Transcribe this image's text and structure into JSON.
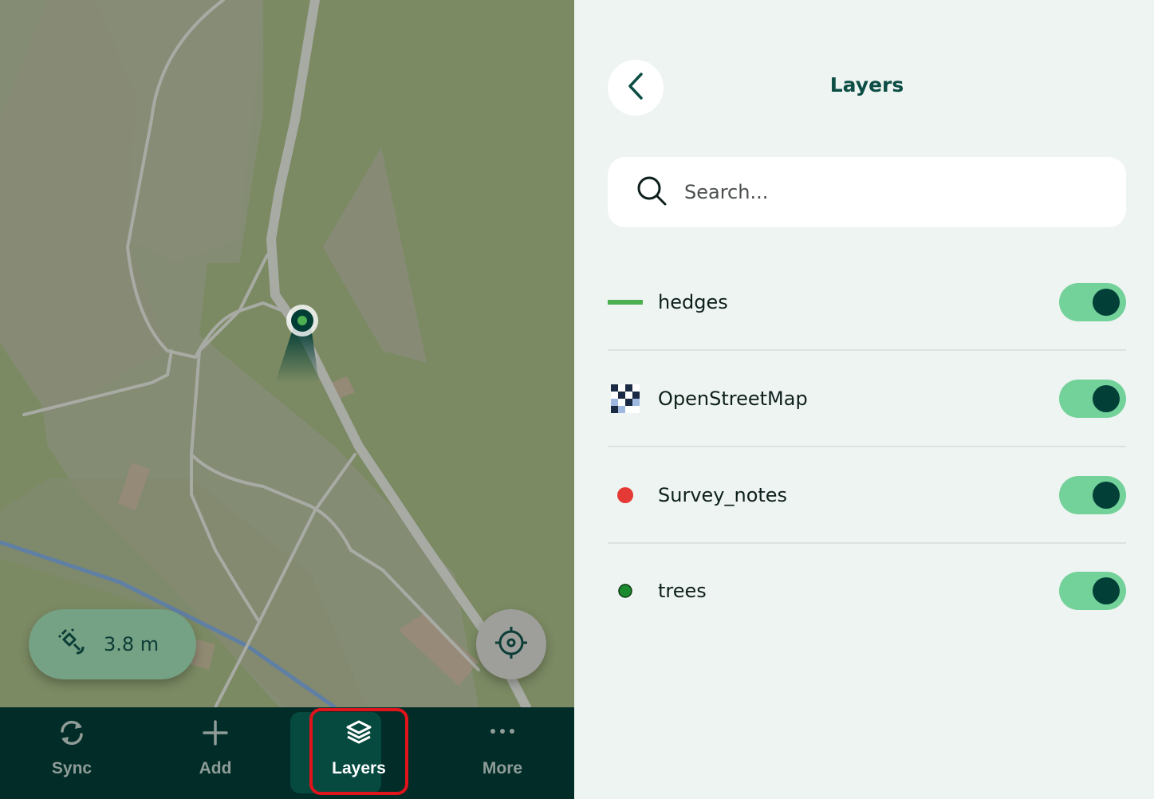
{
  "map": {
    "gps_accuracy": "3.8 m",
    "colors": {
      "background": "#7b8a63",
      "areas": "#868c75",
      "paths": "#a8aaa4",
      "water": "#5f7fa5"
    }
  },
  "bottom_nav": {
    "items": [
      {
        "label": "Sync",
        "icon": "sync-icon"
      },
      {
        "label": "Add",
        "icon": "plus-icon"
      },
      {
        "label": "Layers",
        "icon": "layers-icon",
        "active": true
      },
      {
        "label": "More",
        "icon": "more-icon"
      }
    ]
  },
  "layers_panel": {
    "title": "Layers",
    "search": {
      "placeholder": "Search...",
      "value": ""
    },
    "layers": [
      {
        "name": "hedges",
        "icon": "line-symbol",
        "color": "#4caf50",
        "visible": true
      },
      {
        "name": "OpenStreetMap",
        "icon": "raster-tile-icon",
        "visible": true
      },
      {
        "name": "Survey_notes",
        "icon": "point-symbol",
        "color": "#e53935",
        "visible": true
      },
      {
        "name": "trees",
        "icon": "point-symbol",
        "color": "#1b8a2e",
        "visible": true
      }
    ]
  },
  "colors": {
    "accent_dark": "#012c27",
    "toggle_track": "#73d19a",
    "toggle_knob": "#013f37",
    "highlight": "#e0141c"
  }
}
